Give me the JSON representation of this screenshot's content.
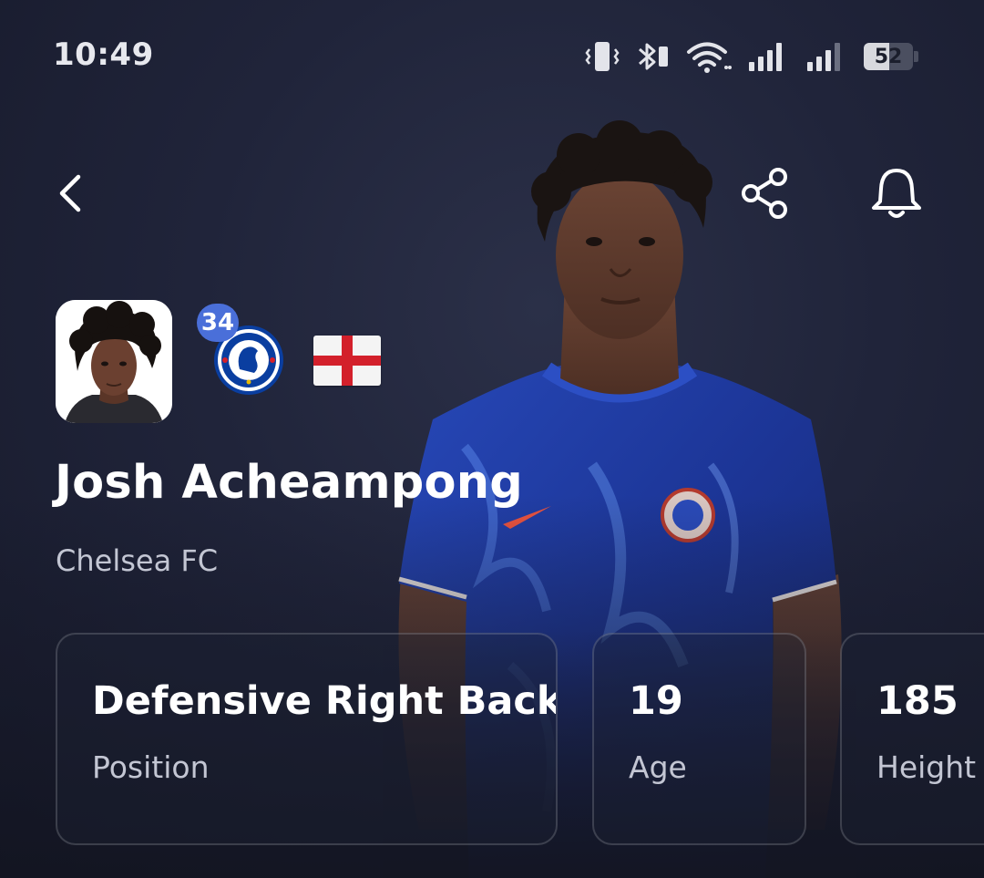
{
  "status_bar": {
    "time": "10:49",
    "battery_level": 52,
    "battery_text": "52",
    "icons": [
      "vibrate-icon",
      "bluetooth-icon",
      "wifi-icon",
      "signal-icon",
      "signal-icon",
      "battery-icon"
    ]
  },
  "toolbar": {
    "icons": [
      "back-icon",
      "share-icon",
      "bell-icon"
    ]
  },
  "player": {
    "name": "Josh Acheampong",
    "club": "Chelsea FC",
    "shirt_number": "34",
    "nationality_flag": "england-flag-icon",
    "club_badge": "chelsea-badge-icon"
  },
  "stats": [
    {
      "value": "Defensive Right Back",
      "label": "Position"
    },
    {
      "value": "19",
      "label": "Age"
    },
    {
      "value": "185",
      "label": "Height"
    }
  ],
  "colors": {
    "background": "#20243a",
    "number_badge": "#4a6fd9",
    "shirt": "#1f3fa8",
    "secondary_text": "#c3c6d3"
  }
}
